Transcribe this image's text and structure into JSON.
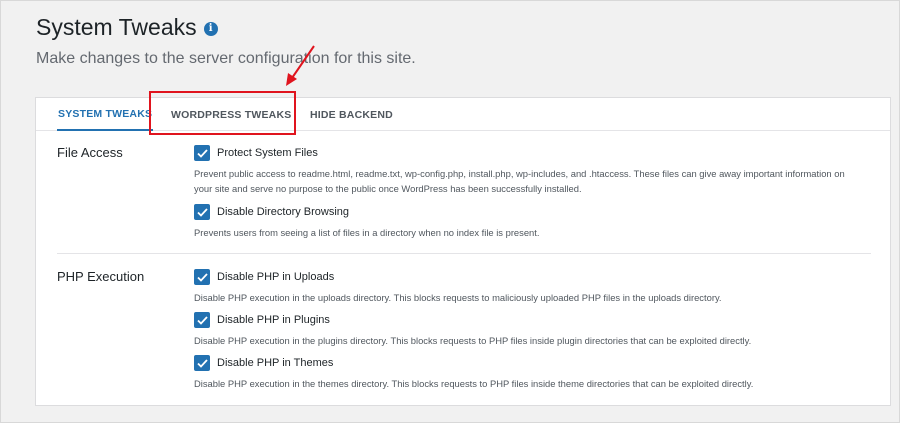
{
  "header": {
    "title": "System Tweaks",
    "info_icon": "i",
    "subtitle": "Make changes to the server configuration for this site."
  },
  "tabs": [
    {
      "label": "SYSTEM TWEAKS",
      "active": true
    },
    {
      "label": "WORDPRESS TWEAKS",
      "active": false
    },
    {
      "label": "HIDE BACKEND",
      "active": false
    }
  ],
  "sections": {
    "file_access": {
      "label": "File Access",
      "options": [
        {
          "label": "Protect System Files",
          "checked": true,
          "description": "Prevent public access to readme.html, readme.txt, wp-config.php, install.php, wp-includes, and .htaccess. These files can give away important information on your site and serve no purpose to the public once WordPress has been successfully installed."
        },
        {
          "label": "Disable Directory Browsing",
          "checked": true,
          "description": "Prevents users from seeing a list of files in a directory when no index file is present."
        }
      ]
    },
    "php_execution": {
      "label": "PHP Execution",
      "options": [
        {
          "label": "Disable PHP in Uploads",
          "checked": true,
          "description": "Disable PHP execution in the uploads directory. This blocks requests to maliciously uploaded PHP files in the uploads directory."
        },
        {
          "label": "Disable PHP in Plugins",
          "checked": true,
          "description": "Disable PHP execution in the plugins directory. This blocks requests to PHP files inside plugin directories that can be exploited directly."
        },
        {
          "label": "Disable PHP in Themes",
          "checked": true,
          "description": "Disable PHP execution in the themes directory. This blocks requests to PHP files inside theme directories that can be exploited directly."
        }
      ]
    }
  },
  "colors": {
    "accent": "#2271b1",
    "annotation": "#e0141e"
  }
}
